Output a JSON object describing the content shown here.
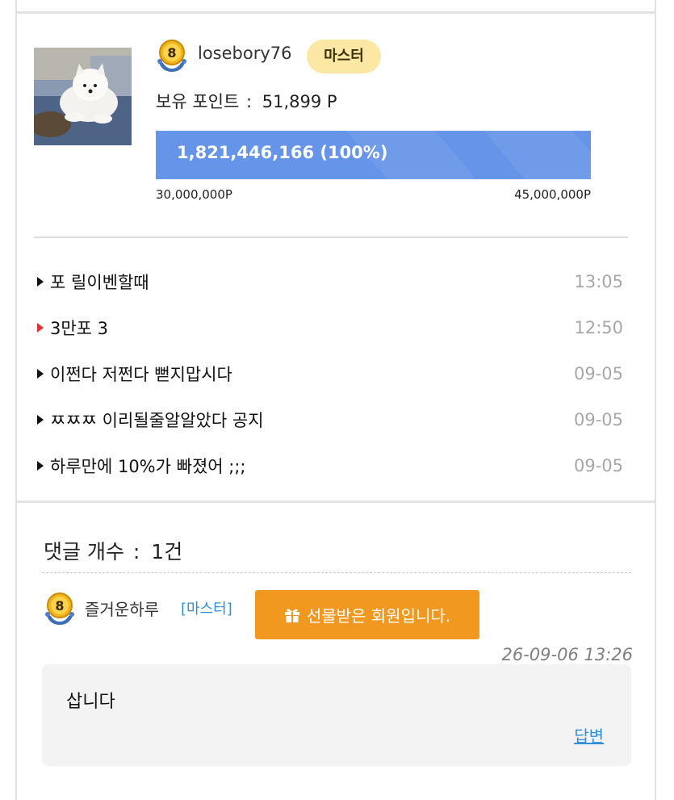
{
  "profile": {
    "level": "8",
    "username": "losebory76",
    "grade": "마스터",
    "points_label": "보유 포인트",
    "points_separator": ":",
    "points_value": "51,899 P",
    "progress": {
      "text": "1,821,446,166 (100%)",
      "percent": 100,
      "range_min": "30,000,000P",
      "range_max": "45,000,000P"
    }
  },
  "posts": [
    {
      "title": "포 릴이벤할때",
      "time": "13:05",
      "arrow_color": "#111111"
    },
    {
      "title": "3만포 3",
      "time": "12:50",
      "arrow_color": "#e53131"
    },
    {
      "title": "이쩐다 저쩐다 뻗지맙시다",
      "time": "09-05",
      "arrow_color": "#111111"
    },
    {
      "title": "ㅉㅉㅉ 이리될줄알알았다 공지",
      "time": "09-05",
      "arrow_color": "#111111"
    },
    {
      "title": "하루만에 10%가 빠졌어 ;;;",
      "time": "09-05",
      "arrow_color": "#111111"
    }
  ],
  "comments_section": {
    "count_label": "댓글 개수",
    "count_separator": ":",
    "count_value": "1건",
    "comments": [
      {
        "level": "8",
        "name": "즐거운하루",
        "grade": "[마스터]",
        "gift_label": "선물받은 회원입니다.",
        "time": "26-09-06 13:26",
        "body": "삽니다",
        "reply_label": "답변"
      }
    ]
  },
  "colors": {
    "accent_blue": "#6694e8",
    "grade_pill": "#fde7a5",
    "gift_orange": "#f0981f",
    "link_blue": "#2f8fd8",
    "new_post_red": "#e53131"
  },
  "icons": {
    "level_badge": "level-8-medal-icon",
    "gift": "gift-icon",
    "post_arrow": "triangle-right-icon"
  }
}
